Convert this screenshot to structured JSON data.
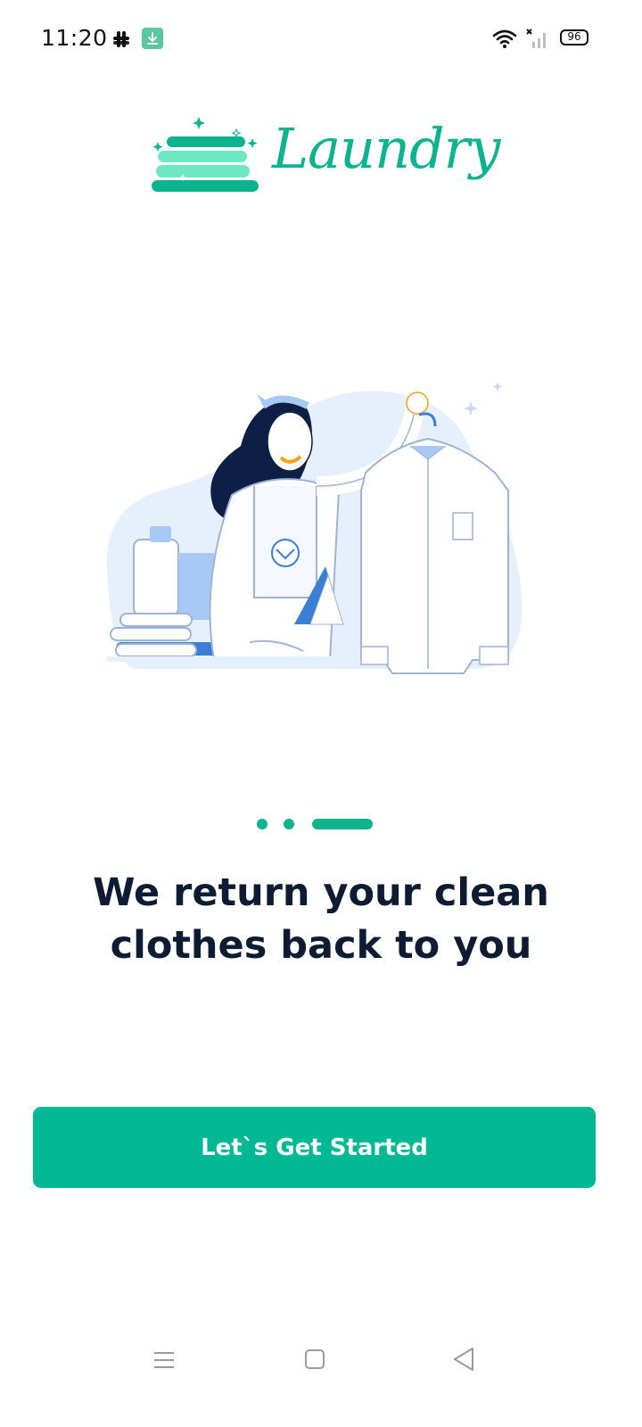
{
  "status_bar": {
    "time": "11:20",
    "battery": "96",
    "icons": [
      "slack-icon",
      "download-icon",
      "wifi-icon",
      "signal-icon",
      "battery-icon"
    ]
  },
  "brand": {
    "name": "Laundry",
    "accent_color": "#0db38f"
  },
  "onboarding": {
    "page_indicator": {
      "total": 3,
      "active_index": 2
    },
    "headline": "We return your clean clothes back to you"
  },
  "cta": {
    "label": "Let`s Get Started",
    "color": "#00b894"
  },
  "nav_bar": {
    "buttons": [
      "menu-icon",
      "home-icon",
      "back-icon"
    ]
  }
}
